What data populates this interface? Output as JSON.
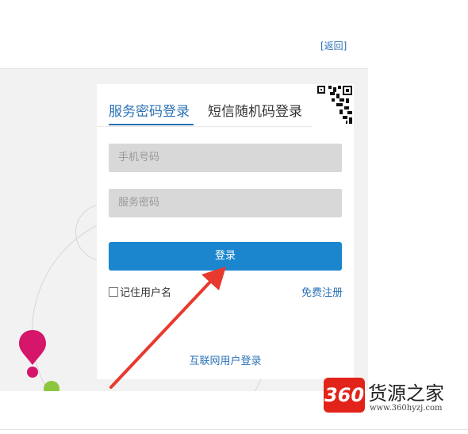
{
  "header": {
    "back_label": "[返回]"
  },
  "login": {
    "tab_service_password": "服务密码登录",
    "tab_sms_code": "短信随机码登录",
    "phone_placeholder": "手机号码",
    "password_placeholder": "服务密码",
    "login_button": "登录",
    "remember_label": "记住用户名",
    "register_link": "免费注册",
    "internet_user_login": "互联网用户登录"
  },
  "watermark": {
    "badge": "360",
    "title": "货源之家",
    "url": "www.360hyzj.com"
  },
  "icons": [
    "qr-code-icon",
    "map-pin-icon",
    "red-arrow-annotation"
  ],
  "colors": {
    "accent_blue": "#1b86cd",
    "tab_blue": "#2a72b5",
    "field_gray": "#d8d8d8",
    "stage_gray": "#f2f2f2",
    "arrow_red": "#e8392f",
    "pin_pink": "#d5166a",
    "dot_green": "#8cc63f",
    "badge_red": "#e2231a"
  }
}
